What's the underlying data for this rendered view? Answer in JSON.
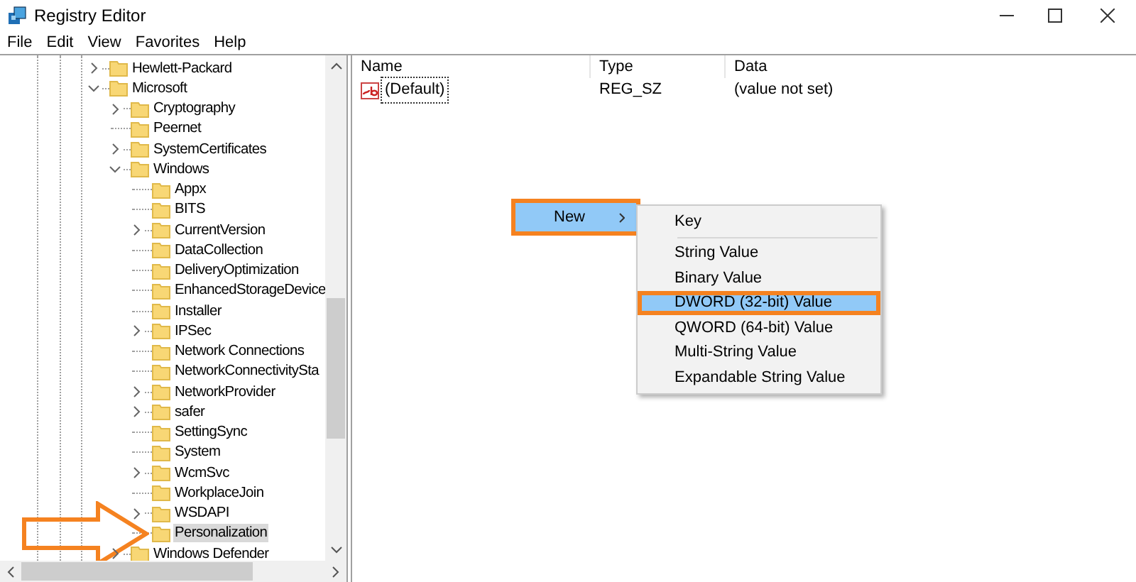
{
  "window": {
    "title": "Registry Editor"
  },
  "menu_bar": [
    "File",
    "Edit",
    "View",
    "Favorites",
    "Help"
  ],
  "tree": [
    {
      "label": "Hewlett-Packard",
      "expandable": true,
      "expanded": false,
      "selected": false,
      "arrow_callout": false
    },
    {
      "label": "Microsoft",
      "expandable": true,
      "expanded": true,
      "selected": false,
      "arrow_callout": false,
      "children": [
        {
          "label": "Cryptography",
          "expandable": true,
          "expanded": false,
          "selected": false,
          "arrow_callout": false
        },
        {
          "label": "Peernet",
          "expandable": false,
          "selected": false,
          "arrow_callout": false
        },
        {
          "label": "SystemCertificates",
          "expandable": true,
          "expanded": false,
          "selected": false,
          "arrow_callout": false
        },
        {
          "label": "Windows",
          "expandable": true,
          "expanded": true,
          "selected": false,
          "arrow_callout": false,
          "children": [
            {
              "label": "Appx",
              "expandable": false,
              "selected": false,
              "arrow_callout": false
            },
            {
              "label": "BITS",
              "expandable": false,
              "selected": false,
              "arrow_callout": false
            },
            {
              "label": "CurrentVersion",
              "expandable": true,
              "expanded": false,
              "selected": false,
              "arrow_callout": false
            },
            {
              "label": "DataCollection",
              "expandable": false,
              "selected": false,
              "arrow_callout": false
            },
            {
              "label": "DeliveryOptimization",
              "expandable": false,
              "selected": false,
              "arrow_callout": false
            },
            {
              "label": "EnhancedStorageDevice",
              "expandable": false,
              "selected": false,
              "arrow_callout": false
            },
            {
              "label": "Installer",
              "expandable": false,
              "selected": false,
              "arrow_callout": false
            },
            {
              "label": "IPSec",
              "expandable": true,
              "expanded": false,
              "selected": false,
              "arrow_callout": false
            },
            {
              "label": "Network Connections",
              "expandable": false,
              "selected": false,
              "arrow_callout": false
            },
            {
              "label": "NetworkConnectivitySta",
              "expandable": false,
              "selected": false,
              "arrow_callout": false
            },
            {
              "label": "NetworkProvider",
              "expandable": true,
              "expanded": false,
              "selected": false,
              "arrow_callout": false
            },
            {
              "label": "safer",
              "expandable": true,
              "expanded": false,
              "selected": false,
              "arrow_callout": false
            },
            {
              "label": "SettingSync",
              "expandable": false,
              "selected": false,
              "arrow_callout": false
            },
            {
              "label": "System",
              "expandable": false,
              "selected": false,
              "arrow_callout": false
            },
            {
              "label": "WcmSvc",
              "expandable": true,
              "expanded": false,
              "selected": false,
              "arrow_callout": false
            },
            {
              "label": "WorkplaceJoin",
              "expandable": false,
              "selected": false,
              "arrow_callout": false
            },
            {
              "label": "WSDAPI",
              "expandable": true,
              "expanded": false,
              "selected": false,
              "arrow_callout": false
            },
            {
              "label": "Personalization",
              "expandable": false,
              "selected": true,
              "arrow_callout": true
            }
          ]
        },
        {
          "label": "Windows Defender",
          "expandable": true,
          "expanded": false,
          "selected": false,
          "arrow_callout": false
        }
      ]
    }
  ],
  "values_table": {
    "columns": [
      "Name",
      "Type",
      "Data"
    ],
    "rows": [
      {
        "name": "(Default)",
        "type": "REG_SZ",
        "data": "(value not set)",
        "focused": true
      }
    ]
  },
  "context_menu": {
    "items": [
      {
        "label": "New",
        "selected": true,
        "highlighted": true
      }
    ]
  },
  "submenu": {
    "items": [
      {
        "kind": "item",
        "label": "Key",
        "selected": false,
        "highlighted": false
      },
      {
        "kind": "separator"
      },
      {
        "kind": "item",
        "label": "String Value",
        "selected": false,
        "highlighted": false
      },
      {
        "kind": "item",
        "label": "Binary Value",
        "selected": false,
        "highlighted": false
      },
      {
        "kind": "item",
        "label": "DWORD (32-bit) Value",
        "selected": true,
        "highlighted": true
      },
      {
        "kind": "item",
        "label": "QWORD (64-bit) Value",
        "selected": false,
        "highlighted": false
      },
      {
        "kind": "item",
        "label": "Multi-String Value",
        "selected": false,
        "highlighted": false
      },
      {
        "kind": "item",
        "label": "Expandable String Value",
        "selected": false,
        "highlighted": false
      }
    ]
  }
}
